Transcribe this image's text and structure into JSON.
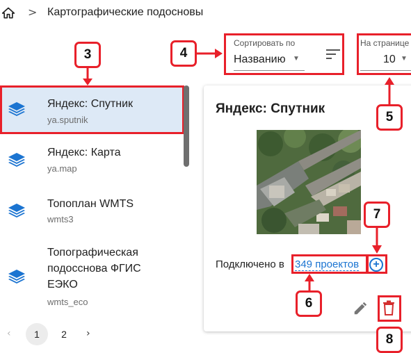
{
  "breadcrumb": {
    "home_icon": "home-icon",
    "separator": ">",
    "title": "Картографические подосновы"
  },
  "sort": {
    "label": "Сортировать по",
    "value": "Названию",
    "order_icon": "sort-order-icon"
  },
  "per_page": {
    "label": "На странице",
    "value": "10"
  },
  "list": {
    "items": [
      {
        "title": "Яндекс: Спутник",
        "subtitle": "ya.sputnik",
        "selected": true
      },
      {
        "title": "Яндекс: Карта",
        "subtitle": "ya.map",
        "selected": false
      },
      {
        "title": "Топоплан WMTS",
        "subtitle": "wmts3",
        "selected": false
      },
      {
        "title_lines": [
          "Топографическая",
          "подосснова ФГИС",
          "ЕЭКО"
        ],
        "subtitle": "wmts_eco",
        "selected": false
      }
    ]
  },
  "pagination": {
    "prev": "‹",
    "pages": [
      "1",
      "2"
    ],
    "current": "1",
    "next": "›"
  },
  "detail": {
    "title": "Яндекс: Спутник",
    "used_label": "Подключено в",
    "used_link": "349 проектов",
    "add_icon": "add-circle-icon",
    "edit_icon": "pencil-icon",
    "delete_icon": "trash-icon"
  },
  "callouts": [
    "3",
    "4",
    "5",
    "6",
    "7",
    "8"
  ],
  "colors": {
    "accent": "#1b74d1",
    "annotation": "#e8202a",
    "selected_bg": "#dde9f6"
  }
}
